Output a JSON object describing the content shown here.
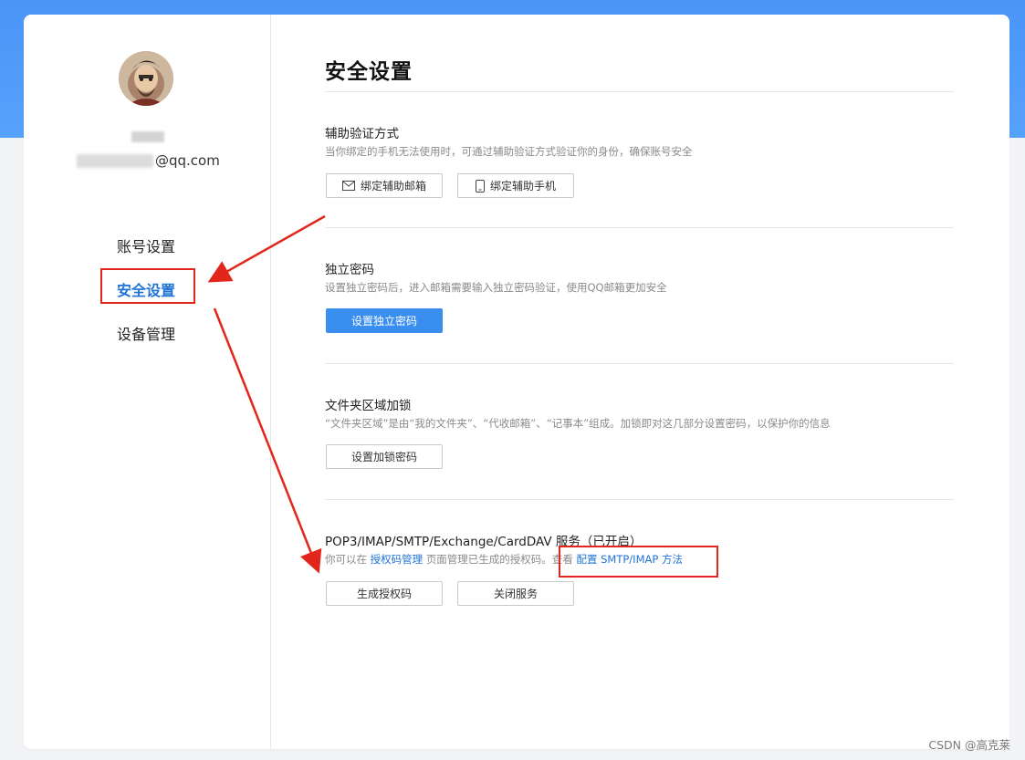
{
  "sidebar": {
    "email_suffix": "@qq.com",
    "items": [
      {
        "label": "账号设置"
      },
      {
        "label": "安全设置",
        "active": true
      },
      {
        "label": "设备管理"
      }
    ]
  },
  "main": {
    "title": "安全设置",
    "sections": [
      {
        "title": "辅助验证方式",
        "desc": "当你绑定的手机无法使用时，可通过辅助验证方式验证你的身份，确保账号安全",
        "buttons": [
          {
            "label": "绑定辅助邮箱",
            "icon": "mail-icon"
          },
          {
            "label": "绑定辅助手机",
            "icon": "phone-icon"
          }
        ]
      },
      {
        "title": "独立密码",
        "desc": "设置独立密码后，进入邮箱需要输入独立密码验证，使用QQ邮箱更加安全",
        "buttons": [
          {
            "label": "设置独立密码",
            "primary": true
          }
        ]
      },
      {
        "title": "文件夹区域加锁",
        "desc": "“文件夹区域”是由“我的文件夹”、“代收邮箱”、“记事本”组成。加锁即对这几部分设置密码，以保护你的信息",
        "buttons": [
          {
            "label": "设置加锁密码"
          }
        ]
      },
      {
        "title": "POP3/IMAP/SMTP/Exchange/CardDAV 服务（已开启）",
        "desc_prefix": "你可以在",
        "desc_link1": "授权码管理",
        "desc_middle": "页面管理已生成的授权码。查看",
        "desc_link2": "配置 SMTP/IMAP 方法",
        "buttons": [
          {
            "label": "生成授权码"
          },
          {
            "label": "关闭服务"
          }
        ]
      }
    ]
  },
  "watermark": "CSDN @高克莱",
  "colors": {
    "accent": "#1f73d6",
    "primary_button": "#3a8ef0",
    "annotation": "#e3261c",
    "top_band": "#4a95f7"
  }
}
